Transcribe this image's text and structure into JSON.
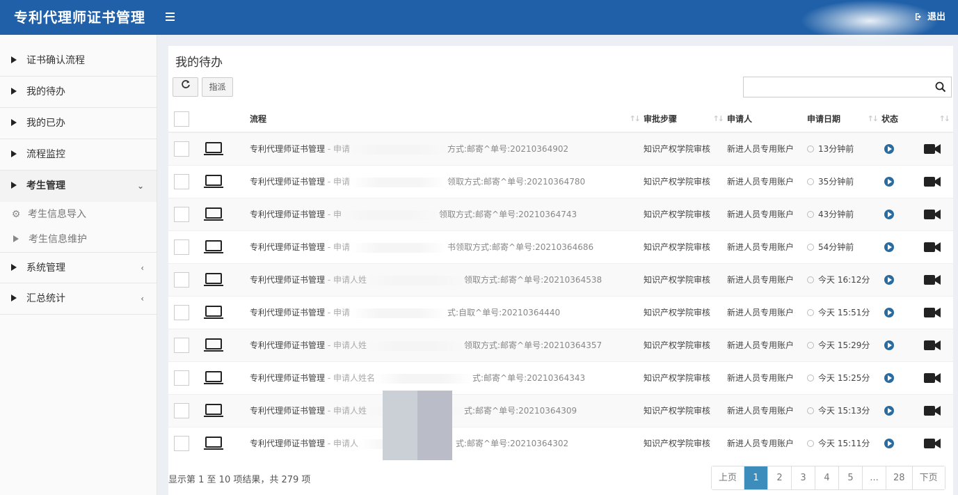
{
  "app": {
    "title": "专利代理师证书管理",
    "logout_label": "退出"
  },
  "sidebar": {
    "items": [
      {
        "label": "证书确认流程"
      },
      {
        "label": "我的待办"
      },
      {
        "label": "我的已办"
      },
      {
        "label": "流程监控"
      },
      {
        "label": "考生管理"
      },
      {
        "label": "系统管理"
      },
      {
        "label": "汇总统计"
      }
    ],
    "subitems": [
      {
        "label": "考生信息导入",
        "icon": "gear-icon"
      },
      {
        "label": "考生信息维护",
        "icon": "triangle-icon"
      }
    ]
  },
  "main": {
    "title": "我的待办",
    "assign_label": "指派",
    "search_placeholder": "",
    "columns": {
      "flow": "流程",
      "step": "审批步骤",
      "applicant": "申请人",
      "date": "申请日期",
      "status": "状态"
    },
    "rows": [
      {
        "flow": "专利代理师证书管理",
        "sub": " - 申请",
        "detail": "方式:邮寄^单号:20210364902",
        "step": "知识产权学院审核",
        "applicant": "新进人员专用账户",
        "date": "13分钟前"
      },
      {
        "flow": "专利代理师证书管理",
        "sub": " - 申请",
        "detail": "领取方式:邮寄^单号:20210364780",
        "step": "知识产权学院审核",
        "applicant": "新进人员专用账户",
        "date": "35分钟前"
      },
      {
        "flow": "专利代理师证书管理",
        "sub": " - 申",
        "detail": "领取方式:邮寄^单号:20210364743",
        "step": "知识产权学院审核",
        "applicant": "新进人员专用账户",
        "date": "43分钟前"
      },
      {
        "flow": "专利代理师证书管理",
        "sub": " - 申请",
        "detail": "书领取方式:邮寄^单号:20210364686",
        "step": "知识产权学院审核",
        "applicant": "新进人员专用账户",
        "date": "54分钟前"
      },
      {
        "flow": "专利代理师证书管理",
        "sub": " - 申请人姓",
        "detail": "领取方式:邮寄^单号:20210364538",
        "step": "知识产权学院审核",
        "applicant": "新进人员专用账户",
        "date": "今天 16:12分"
      },
      {
        "flow": "专利代理师证书管理",
        "sub": " - 申请",
        "detail": "式:自取^单号:20210364440",
        "step": "知识产权学院审核",
        "applicant": "新进人员专用账户",
        "date": "今天 15:51分"
      },
      {
        "flow": "专利代理师证书管理",
        "sub": " - 申请人姓",
        "detail": "领取方式:邮寄^单号:20210364357",
        "step": "知识产权学院审核",
        "applicant": "新进人员专用账户",
        "date": "今天 15:29分"
      },
      {
        "flow": "专利代理师证书管理",
        "sub": " - 申请人姓名",
        "detail": "式:邮寄^单号:20210364343",
        "step": "知识产权学院审核",
        "applicant": "新进人员专用账户",
        "date": "今天 15:25分"
      },
      {
        "flow": "专利代理师证书管理",
        "sub": " - 申请人姓",
        "detail": "式:邮寄^单号:20210364309",
        "step": "知识产权学院审核",
        "applicant": "新进人员专用账户",
        "date": "今天 15:13分"
      },
      {
        "flow": "专利代理师证书管理",
        "sub": " - 申请人",
        "detail": "式:邮寄^单号:20210364302",
        "step": "知识产权学院审核",
        "applicant": "新进人员专用账户",
        "date": "今天 15:11分"
      }
    ],
    "footer_info": "显示第 1 至 10 项结果，共 279 项",
    "pager": [
      "上页",
      "1",
      "2",
      "3",
      "4",
      "5",
      "...",
      "28",
      "下页"
    ],
    "pager_active": "1"
  }
}
